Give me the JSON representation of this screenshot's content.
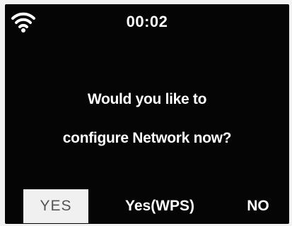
{
  "status_bar": {
    "icon": "wifi-icon",
    "time": "00:02"
  },
  "dialog": {
    "message_line1": "Would you like to",
    "message_line2": "configure Network now?"
  },
  "options": [
    {
      "label": "YES",
      "selected": true
    },
    {
      "label": "Yes(WPS)",
      "selected": false
    },
    {
      "label": "NO",
      "selected": false
    }
  ],
  "colors": {
    "screen_background": "#050505",
    "text": "#ffffff",
    "selection_background": "#f0f0f0",
    "selection_text": "#555555"
  }
}
